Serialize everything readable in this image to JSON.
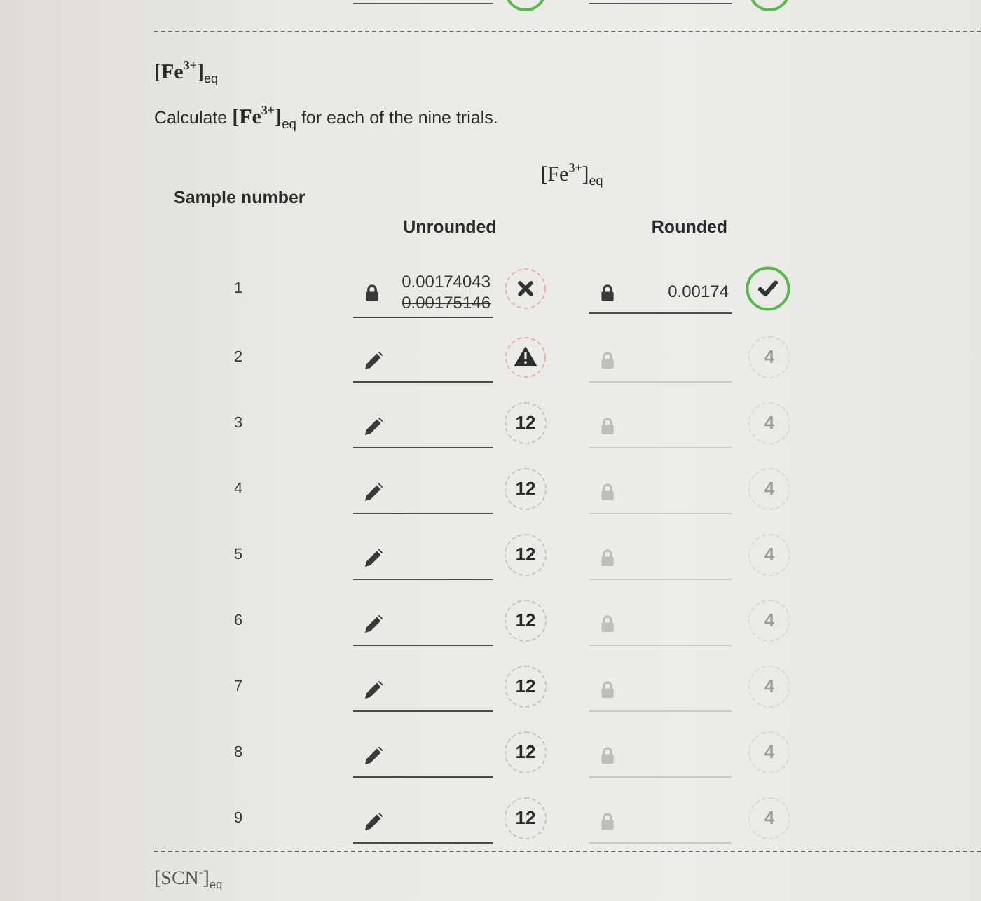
{
  "previous_row": {
    "cells": [
      {
        "status": {
          "kind": "correct"
        }
      },
      {
        "status": {
          "kind": "correct"
        }
      }
    ]
  },
  "title": "[Fe$^{3+}$]$_{eq}$",
  "instruction": "Calculate **[Fe$^{3+}$]**$_{eq}$ for each of the nine trials.",
  "table": {
    "group_heading": "[Fe$^{3+}$]$_{eq}$",
    "row_heading": "Sample number",
    "columns": [
      "Unrounded",
      "Rounded"
    ],
    "rows": [
      {
        "sample": "1",
        "unrounded": {
          "kind": "locked",
          "disabled": false,
          "value": "0.00174043",
          "previous_value": "0.00175146",
          "status": {
            "kind": "wrong"
          }
        },
        "rounded": {
          "kind": "locked",
          "disabled": false,
          "value": "0.00174",
          "status": {
            "kind": "correct"
          }
        }
      },
      {
        "sample": "2",
        "unrounded": {
          "kind": "edit",
          "disabled": false,
          "status": {
            "kind": "warning"
          }
        },
        "rounded": {
          "kind": "locked",
          "disabled": true,
          "status": {
            "kind": "attempts",
            "text": "4",
            "disabled": true
          }
        }
      },
      {
        "sample": "3",
        "unrounded": {
          "kind": "edit",
          "disabled": false,
          "status": {
            "kind": "attempts",
            "text": "12",
            "disabled": false
          }
        },
        "rounded": {
          "kind": "locked",
          "disabled": true,
          "status": {
            "kind": "attempts",
            "text": "4",
            "disabled": true
          }
        }
      },
      {
        "sample": "4",
        "unrounded": {
          "kind": "edit",
          "disabled": false,
          "status": {
            "kind": "attempts",
            "text": "12",
            "disabled": false
          }
        },
        "rounded": {
          "kind": "locked",
          "disabled": true,
          "status": {
            "kind": "attempts",
            "text": "4",
            "disabled": true
          }
        }
      },
      {
        "sample": "5",
        "unrounded": {
          "kind": "edit",
          "disabled": false,
          "status": {
            "kind": "attempts",
            "text": "12",
            "disabled": false
          }
        },
        "rounded": {
          "kind": "locked",
          "disabled": true,
          "status": {
            "kind": "attempts",
            "text": "4",
            "disabled": true
          }
        }
      },
      {
        "sample": "6",
        "unrounded": {
          "kind": "edit",
          "disabled": false,
          "status": {
            "kind": "attempts",
            "text": "12",
            "disabled": false
          }
        },
        "rounded": {
          "kind": "locked",
          "disabled": true,
          "status": {
            "kind": "attempts",
            "text": "4",
            "disabled": true
          }
        }
      },
      {
        "sample": "7",
        "unrounded": {
          "kind": "edit",
          "disabled": false,
          "status": {
            "kind": "attempts",
            "text": "12",
            "disabled": false
          }
        },
        "rounded": {
          "kind": "locked",
          "disabled": true,
          "status": {
            "kind": "attempts",
            "text": "4",
            "disabled": true
          }
        }
      },
      {
        "sample": "8",
        "unrounded": {
          "kind": "edit",
          "disabled": false,
          "status": {
            "kind": "attempts",
            "text": "12",
            "disabled": false
          }
        },
        "rounded": {
          "kind": "locked",
          "disabled": true,
          "status": {
            "kind": "attempts",
            "text": "4",
            "disabled": true
          }
        }
      },
      {
        "sample": "9",
        "unrounded": {
          "kind": "edit",
          "disabled": false,
          "status": {
            "kind": "attempts",
            "text": "12",
            "disabled": false
          }
        },
        "rounded": {
          "kind": "locked",
          "disabled": true,
          "status": {
            "kind": "attempts",
            "text": "4",
            "disabled": true
          }
        }
      }
    ]
  },
  "next_section": "[SCN$^{-}$]$_{eq}$"
}
